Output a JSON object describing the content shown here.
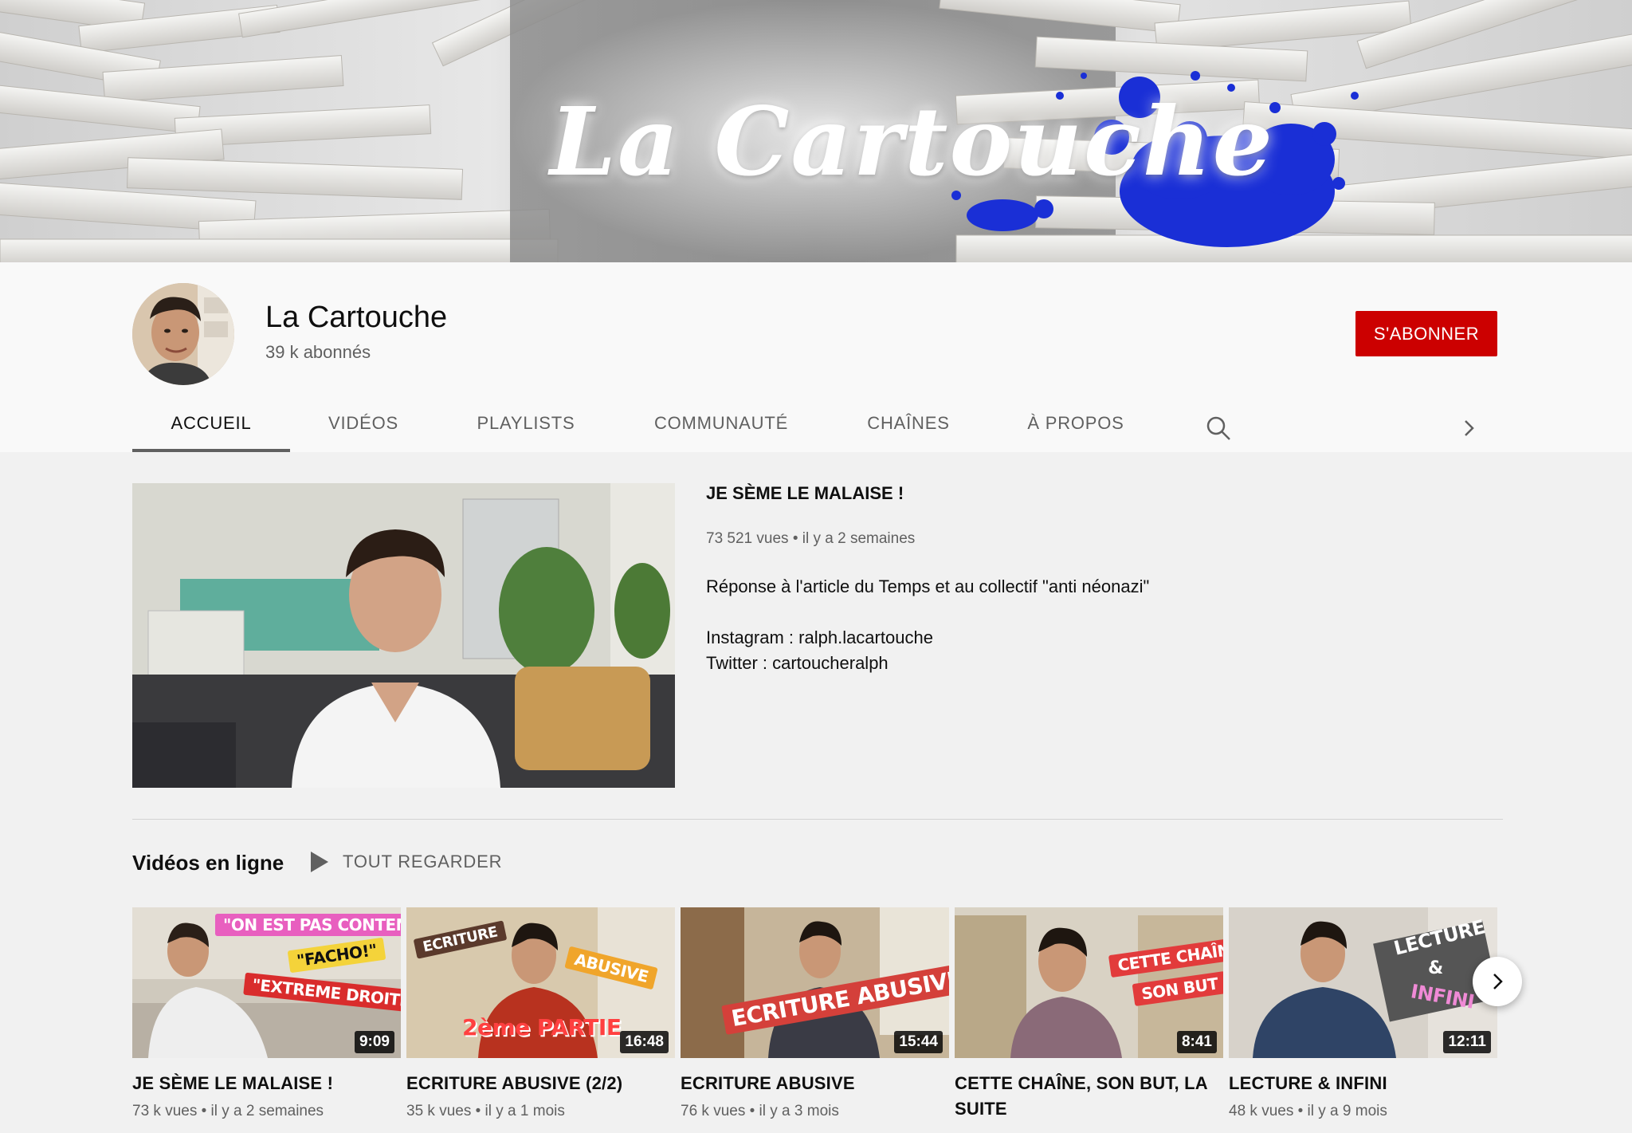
{
  "banner": {
    "title": "La Cartouche"
  },
  "channel": {
    "name": "La Cartouche",
    "subscribers": "39 k abonnés",
    "subscribe_label": "S'ABONNER"
  },
  "tabs": [
    {
      "label": "ACCUEIL",
      "active": true
    },
    {
      "label": "VIDÉOS"
    },
    {
      "label": "PLAYLISTS"
    },
    {
      "label": "COMMUNAUTÉ"
    },
    {
      "label": "CHAÎNES"
    },
    {
      "label": "À PROPOS"
    }
  ],
  "featured": {
    "title": "JE SÈME LE MALAISE !",
    "views": "73 521 vues",
    "age": "il y a 2 semaines",
    "description": [
      "Réponse à l'article du Temps et au collectif \"anti néonazi\"",
      "",
      "Instagram : ralph.lacartouche",
      "Twitter : cartoucheralph"
    ]
  },
  "shelf": {
    "title": "Vidéos en ligne",
    "play_all": "TOUT REGARDER",
    "videos": [
      {
        "title": "JE SÈME LE MALAISE !",
        "views": "73 k vues",
        "age": "il y a 2 semaines",
        "duration": "9:09",
        "overlays": [
          "\"ON EST PAS CONTENTS !\"",
          "\"FACHO!\"",
          "\"EXTREME DROITE!\""
        ]
      },
      {
        "title": "ECRITURE ABUSIVE (2/2)",
        "views": "35 k vues",
        "age": "il y a 1 mois",
        "duration": "16:48",
        "overlays": [
          "ECRITURE",
          "ABUSIVE",
          "2ème PARTIE"
        ]
      },
      {
        "title": "ECRITURE ABUSIVE",
        "views": "76 k vues",
        "age": "il y a 3 mois",
        "duration": "15:44",
        "overlays": [
          "ECRITURE ABUSIVE"
        ]
      },
      {
        "title": "CETTE CHAÎNE, SON BUT, LA SUITE",
        "views": "",
        "age": "",
        "duration": "8:41",
        "overlays": [
          "CETTE CHAÎNE",
          "SON BUT"
        ]
      },
      {
        "title": "LECTURE & INFINI",
        "views": "48 k vues",
        "age": "il y a 9 mois",
        "duration": "12:11",
        "overlays": [
          "LECTURE",
          "&",
          "INFINI"
        ]
      }
    ]
  },
  "colors": {
    "subscribe": "#cc0000",
    "paint_splash": "#1a2fd6",
    "muted_text": "#606060"
  },
  "icons": [
    "search-icon",
    "chevron-right-icon",
    "play-all-icon"
  ]
}
